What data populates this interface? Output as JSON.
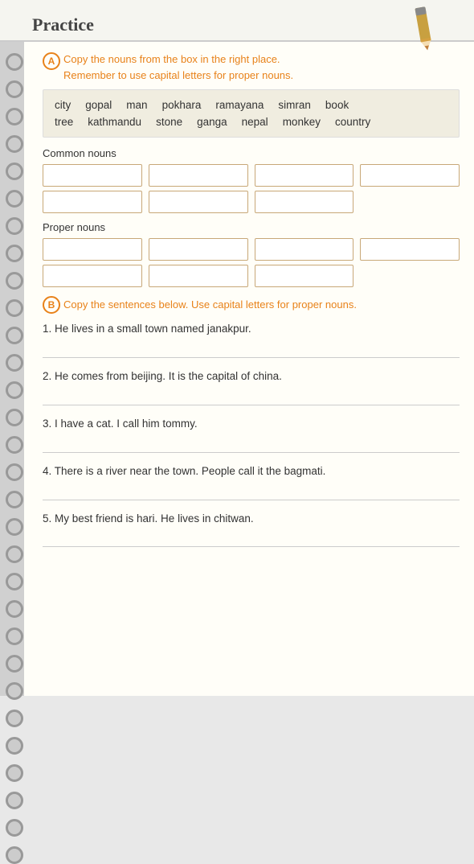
{
  "header": {
    "title": "Practice"
  },
  "section_a": {
    "badge": "A",
    "instruction_line1": "Copy the nouns from the box in the right place.",
    "instruction_line2": "Remember to use capital letters for proper nouns.",
    "word_box_row1": [
      "city",
      "gopal",
      "man",
      "pokhara",
      "ramayana",
      "simran",
      "book"
    ],
    "word_box_row2": [
      "tree",
      "kathmandu",
      "stone",
      "ganga",
      "nepal",
      "monkey",
      "country"
    ],
    "common_nouns_label": "Common nouns",
    "proper_nouns_label": "Proper nouns"
  },
  "section_b": {
    "badge": "B",
    "instruction": "Copy the sentences below. Use capital letters for proper nouns.",
    "sentences": [
      "1. He lives in a small town named janakpur.",
      "2. He comes from beijing. It is the capital of china.",
      "3. I have a cat. I call him tommy.",
      "4. There is a river near the town. People call it the bagmati.",
      "5. My best friend is hari. He lives in chitwan."
    ]
  }
}
